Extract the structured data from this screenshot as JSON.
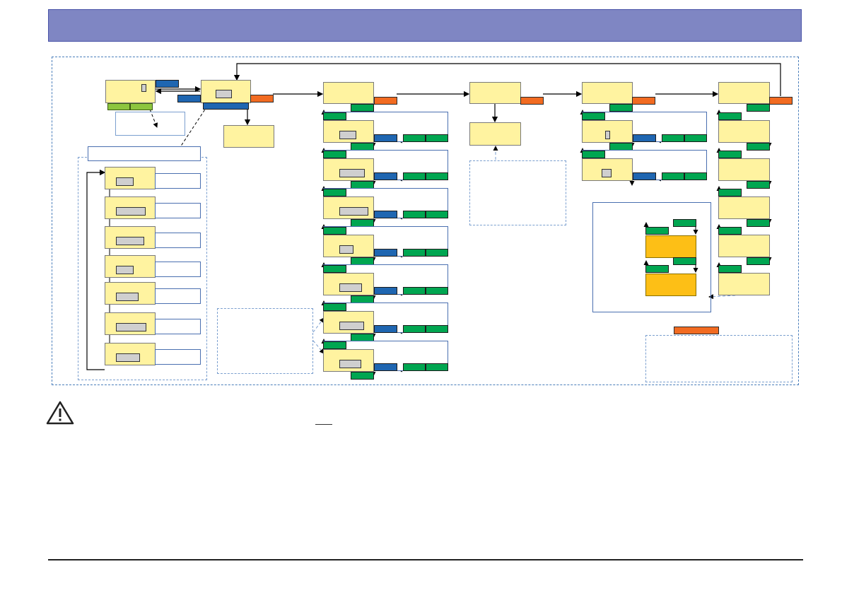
{
  "header": {
    "title": ""
  },
  "warning": {
    "icon": "warning-triangle-icon",
    "note": ""
  },
  "colors": {
    "header": "#7f86c3",
    "menu_box": "#fff3a0",
    "highlight_box": "#fdbf16",
    "green": "#00a651",
    "blue": "#1f66b1",
    "orange": "#f26b21",
    "light_green": "#8dc63f"
  },
  "diagram": {
    "columns": [
      {
        "name": "column-1",
        "menu_items": 7
      },
      {
        "name": "column-2",
        "menu_items": 1
      },
      {
        "name": "column-3",
        "menu_items": 8
      },
      {
        "name": "column-4",
        "menu_items": 2
      },
      {
        "name": "column-5",
        "menu_items": 3
      },
      {
        "name": "column-6",
        "menu_items": 6
      }
    ],
    "labels": []
  }
}
